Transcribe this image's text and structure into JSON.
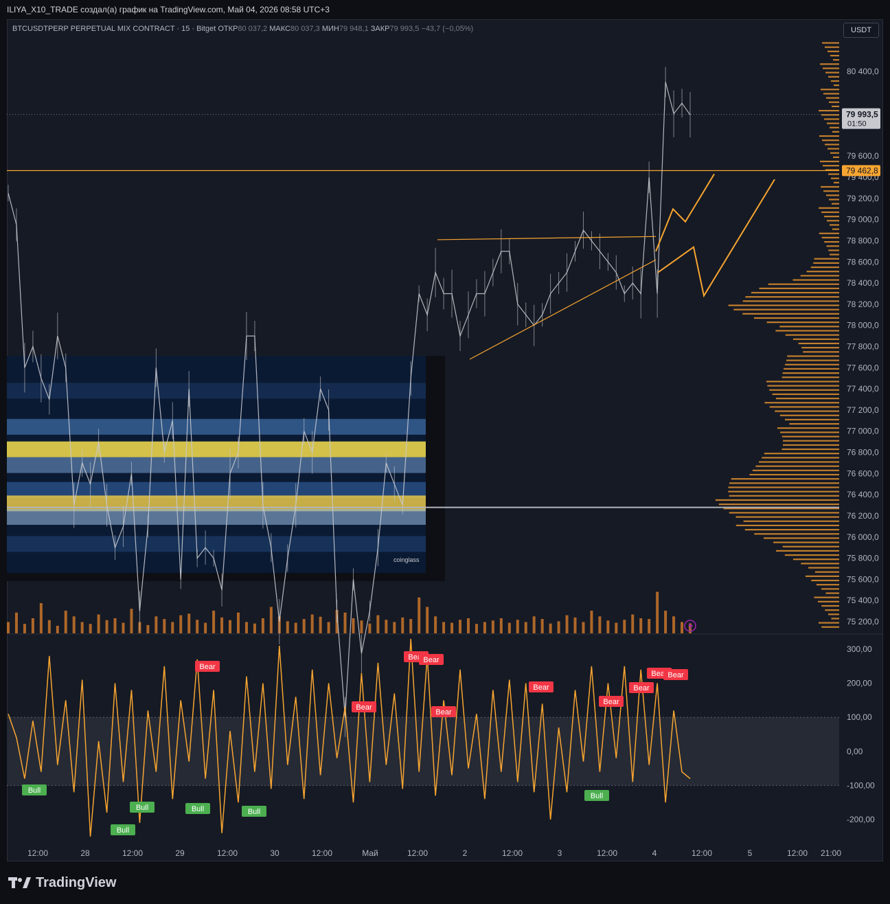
{
  "header": {
    "attribution": "ILIYA_X10_TRADE создал(а) график на TradingView.com, Май 04, 2026 08:58 UTC+3"
  },
  "legend": {
    "symbol": "BTCUSDTPERP PERPETUAL MIX CONTRACT · 15 · Bitget",
    "open_label": "ОТКР",
    "open": "80 037,2",
    "high_label": "МАКС",
    "high": "80 037,3",
    "low_label": "МИН",
    "low": "79 948,1",
    "close_label": "ЗАКР",
    "close": "79 993,5",
    "change": "−43,7 (−0,05%)"
  },
  "currency_button": "USDT",
  "price_badges": {
    "last_price": "79 993,5",
    "countdown": "01:50",
    "level_price": "79 462,8"
  },
  "colors": {
    "background": "#161a24",
    "candles": "#c7c9cf",
    "accent_orange": "#f7a531",
    "volume": "#c9762a",
    "bear_label": "#f23645",
    "bull_label": "#4caf50",
    "level_line_gray": "#b2b5be"
  },
  "watermark": {
    "text": "coinglass"
  },
  "brand": {
    "name": "TradingView"
  },
  "chart_data": [
    {
      "type": "line",
      "title": "",
      "ylim": [
        75100,
        80700
      ],
      "y_ticks": [
        "80 400,0",
        "79 600,0",
        "79 400,0",
        "79 200,0",
        "79 000,0",
        "78 800,0",
        "78 600,0",
        "78 400,0",
        "78 200,0",
        "78 000,0",
        "77 800,0",
        "77 600,0",
        "77 400,0",
        "77 200,0",
        "77 000,0",
        "76 800,0",
        "76 600,0",
        "76 400,0",
        "76 200,0",
        "76 000,0",
        "75 800,0",
        "75 600,0",
        "75 400,0",
        "75 200,0"
      ],
      "x_ticks": [
        "12:00",
        "28",
        "12:00",
        "29",
        "12:00",
        "30",
        "12:00",
        "Май",
        "12:00",
        "2",
        "12:00",
        "3",
        "12:00",
        "4",
        "12:00",
        "5",
        "12:00",
        "21:00"
      ],
      "series": [
        {
          "values": [
            79250,
            78950,
            77600,
            77800,
            77500,
            77300,
            77900,
            77600,
            76300,
            76700,
            76500,
            76900,
            76300,
            75900,
            76100,
            76600,
            75300,
            76100,
            77600,
            76800,
            77100,
            75600,
            77400,
            75800,
            75900,
            75800,
            75500,
            76600,
            76800,
            77900,
            77900,
            76300,
            75900,
            75200,
            75800,
            76300,
            77000,
            76800,
            77400,
            77200,
            75300,
            74300,
            75600,
            74900,
            75300,
            75900,
            76700,
            76500,
            76300,
            77500,
            78300,
            78100,
            78500,
            78300,
            78300,
            77900,
            78100,
            78300,
            78300,
            78500,
            78700,
            78700,
            78200,
            78100,
            78000,
            78100,
            78300,
            78400,
            78500,
            78700,
            78900,
            78800,
            78700,
            78600,
            78500,
            78300,
            78400,
            78300,
            79400,
            78300,
            80300,
            80000,
            80100,
            79990
          ]
        }
      ],
      "horizontal_levels": [
        79462.8,
        76280
      ],
      "annotations": [
        "resistance line near 78 810",
        "rising support trendline",
        "projected zig-zag arrows to 79 460"
      ]
    },
    {
      "type": "bar",
      "title": "",
      "note": "volume histogram under price",
      "values": [
        30,
        55,
        25,
        40,
        80,
        35,
        20,
        60,
        45,
        30,
        25,
        50,
        35,
        40,
        28,
        65,
        30,
        22,
        45,
        38,
        30,
        48,
        52,
        36,
        28,
        60,
        42,
        35,
        55,
        30,
        26,
        40,
        70,
        45,
        32,
        28,
        38,
        50,
        44,
        30,
        62,
        55,
        40,
        34,
        26,
        48,
        36,
        30,
        42,
        38,
        95,
        70,
        45,
        30,
        28,
        36,
        40,
        25,
        30,
        34,
        40,
        28,
        36,
        30,
        45,
        38,
        26,
        32,
        48,
        42,
        30,
        60,
        45,
        34,
        28,
        36,
        50,
        40,
        38,
        110,
        60,
        45,
        30,
        26
      ]
    },
    {
      "type": "line",
      "title": "",
      "ylim": [
        -270,
        345
      ],
      "y_ticks": [
        "300,00",
        "200,00",
        "100,00",
        "0,00",
        "-100,00",
        "-200,00"
      ],
      "band": [
        -100,
        100
      ],
      "series": [
        {
          "values": [
            110,
            40,
            -80,
            90,
            -60,
            280,
            -40,
            150,
            -120,
            210,
            -250,
            30,
            -180,
            200,
            -90,
            180,
            -210,
            120,
            -60,
            250,
            -140,
            150,
            -30,
            270,
            -80,
            180,
            -240,
            60,
            -150,
            220,
            -60,
            200,
            -110,
            310,
            -40,
            160,
            -140,
            240,
            -70,
            200,
            -20,
            130,
            -150,
            230,
            -90,
            260,
            -40,
            170,
            -110,
            330,
            -60,
            280,
            -130,
            150,
            -70,
            240,
            -50,
            110,
            -140,
            180,
            -60,
            210,
            -90,
            200,
            -120,
            140,
            -200,
            70,
            -120,
            180,
            -30,
            250,
            -60,
            200,
            -20,
            250,
            -90,
            240,
            -40,
            200,
            -150,
            120,
            -60,
            -80
          ]
        }
      ],
      "signals": [
        {
          "label": "Bear",
          "count": 11
        },
        {
          "label": "Bull",
          "count": 5
        }
      ]
    }
  ]
}
